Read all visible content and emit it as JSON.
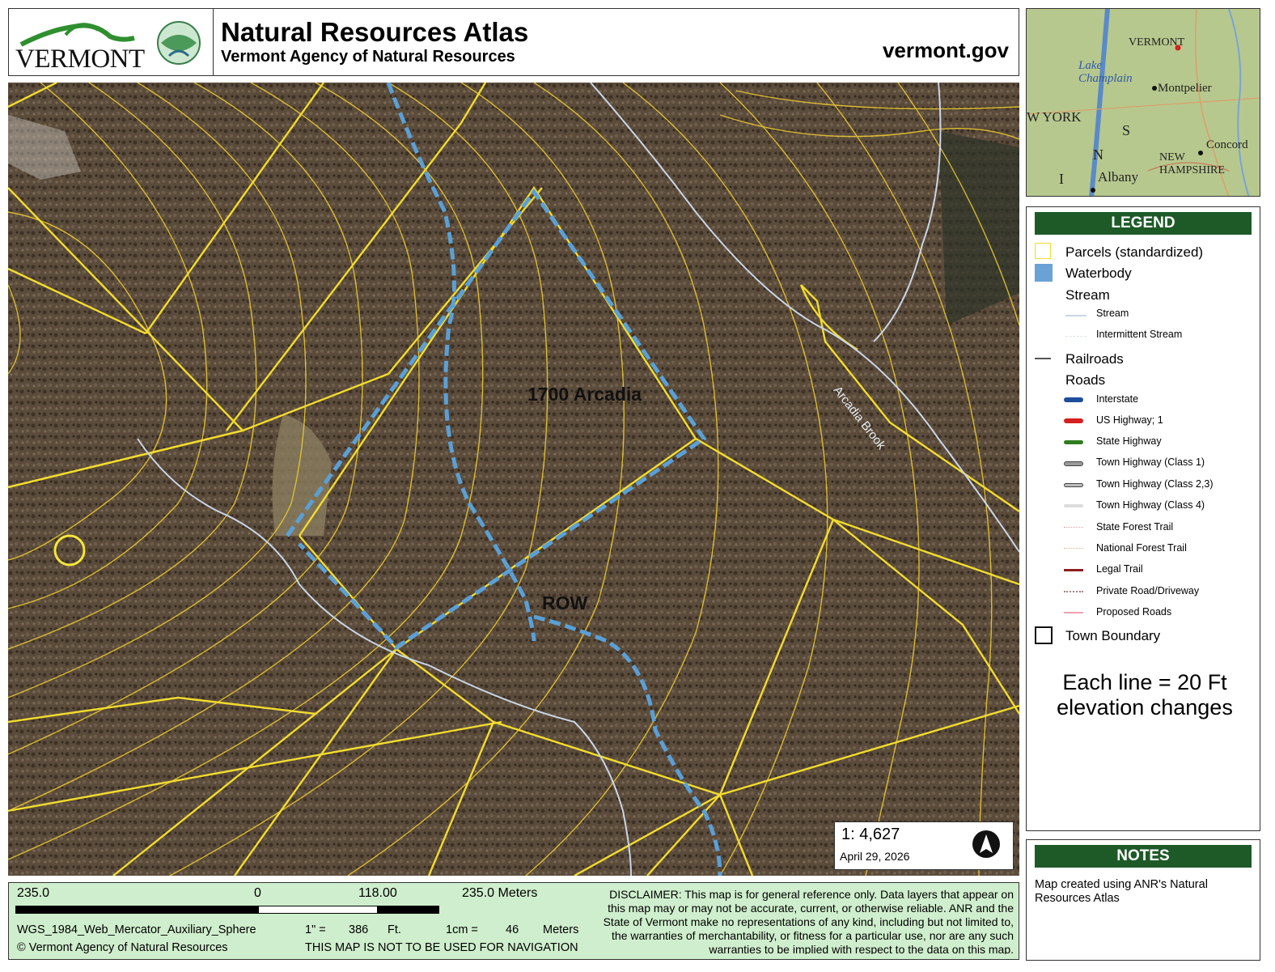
{
  "header": {
    "state_logo_text": "VERMONT",
    "title": "Natural Resources Atlas",
    "subtitle": "Vermont Agency of Natural Resources",
    "site": "vermont.gov"
  },
  "map": {
    "label_parcel": "1700 Arcadia",
    "label_row": "ROW",
    "label_brook": "Arcadia Brook",
    "scale_ratio": "1:  4,627",
    "date": "April 29, 2026"
  },
  "overview": {
    "labels": [
      "VERMONT",
      "Lake Champlain",
      "Montpelier",
      "W YORK",
      "S",
      "Concord",
      "NEW",
      "HAMPSHIRE",
      "Albany",
      "N",
      "I"
    ]
  },
  "legend": {
    "title": "LEGEND",
    "parcels": "Parcels (standardized)",
    "waterbody": "Waterbody",
    "stream_group": "Stream",
    "stream": "Stream",
    "intermittent": "Intermittent Stream",
    "railroads": "Railroads",
    "roads_group": "Roads",
    "roads": [
      {
        "label": "Interstate",
        "color": "#1f4e9a"
      },
      {
        "label": "US Highway; 1",
        "color": "#d62020"
      },
      {
        "label": "State Highway",
        "color": "#2f7d1f"
      },
      {
        "label": "Town Highway (Class 1)",
        "color": "#9a9a9a"
      },
      {
        "label": "Town Highway (Class 2,3)",
        "color": "#bdbdbd"
      },
      {
        "label": "Town Highway (Class 4)",
        "color": "#dcdcdc"
      },
      {
        "label": "State Forest Trail",
        "color": "#e0a0a0"
      },
      {
        "label": "National Forest Trail",
        "color": "#e0b080"
      },
      {
        "label": "Legal Trail",
        "color": "#8a1f1f"
      },
      {
        "label": "Private Road/Driveway",
        "color": "#a08080"
      },
      {
        "label": "Proposed Roads",
        "color": "#f0a0b0"
      }
    ],
    "town_boundary": "Town Boundary",
    "elevation_note_1": "Each line = 20 Ft",
    "elevation_note_2": "elevation changes"
  },
  "notes": {
    "title": "NOTES",
    "text": "Map created using ANR's Natural Resources Atlas"
  },
  "scalebar": {
    "left": "235.0",
    "zero": "0",
    "mid": "118.00",
    "right": "235.0 Meters",
    "projection": "WGS_1984_Web_Mercator_Auxiliary_Sphere",
    "inch_label": "1\" =",
    "inch_value": "386",
    "inch_unit": "Ft.",
    "cm_label": "1cm =",
    "cm_value": "46",
    "cm_unit": "Meters",
    "copyright": "© Vermont Agency of Natural Resources",
    "nav_warning": "THIS MAP IS NOT TO BE USED FOR NAVIGATION",
    "disclaimer": "DISCLAIMER: This map is for general reference only. Data layers that appear on this map may or may not be accurate, current, or otherwise reliable. ANR and the State of Vermont make no representations of any kind, including but not limited to, the warranties of merchantability, or fitness for a particular use, nor are any such warranties to be implied with respect to the data on this map."
  },
  "colors": {
    "parcel_line": "#f2dc2e",
    "contour_line": "#e8c830",
    "row_dash": "#5aa0d6",
    "stream_line": "#c9d6e6",
    "legend_header": "#1e5a28",
    "bottom_bar": "#cfeecd"
  }
}
